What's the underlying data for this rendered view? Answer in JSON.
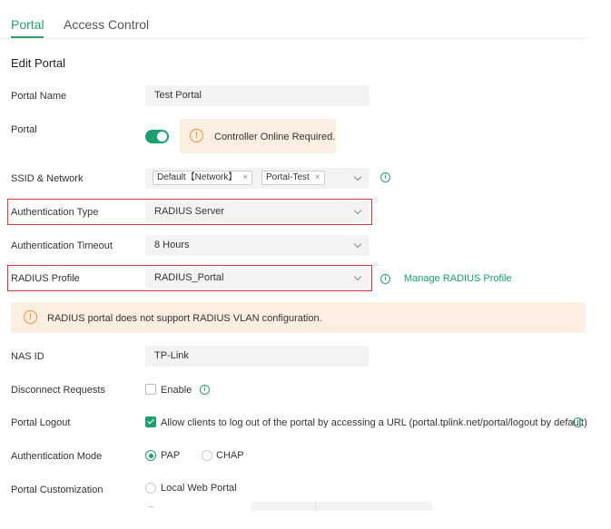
{
  "tabs": [
    {
      "label": "Portal"
    },
    {
      "label": "Access Control"
    }
  ],
  "section_title": "Edit Portal",
  "form": {
    "portal_name": {
      "label": "Portal Name",
      "value": "Test Portal"
    },
    "portal": {
      "label": "Portal",
      "enabled": true,
      "warning": "Controller Online Required."
    },
    "ssid_network": {
      "label": "SSID & Network",
      "chips": [
        "Default【Network】",
        "Portal-Test"
      ]
    },
    "authentication_type": {
      "label": "Authentication Type",
      "value": "RADIUS Server"
    },
    "authentication_timeout": {
      "label": "Authentication Timeout",
      "value": "8 Hours"
    },
    "radius_profile": {
      "label": "RADIUS Profile",
      "value": "RADIUS_Portal",
      "manage_link": "Manage RADIUS Profile"
    },
    "radius_warning": "RADIUS portal does not support RADIUS VLAN configuration.",
    "nas_id": {
      "label": "NAS ID",
      "value": "TP-Link"
    },
    "disconnect_requests": {
      "label": "Disconnect Requests",
      "option": "Enable",
      "checked": false
    },
    "portal_logout": {
      "label": "Portal Logout",
      "option": "Allow clients to log out of the portal by accessing a URL (portal.tplink.net/portal/logout by default)",
      "checked": true
    },
    "authentication_mode": {
      "label": "Authentication Mode",
      "options": [
        "PAP",
        "CHAP"
      ],
      "selected": "PAP"
    },
    "portal_customization": {
      "label": "Portal Customization",
      "options": [
        "Local Web Portal"
      ]
    }
  },
  "colors": {
    "accent": "#1aa06d",
    "highlight_border": "#e0363d",
    "warning_bg": "#fdeee2",
    "warning_icon": "#f0922b"
  },
  "icons": {
    "warning": "exclamation-circle-icon",
    "info": "info-circle-icon",
    "remove": "close-icon",
    "dropdown": "chevron-down-icon"
  }
}
